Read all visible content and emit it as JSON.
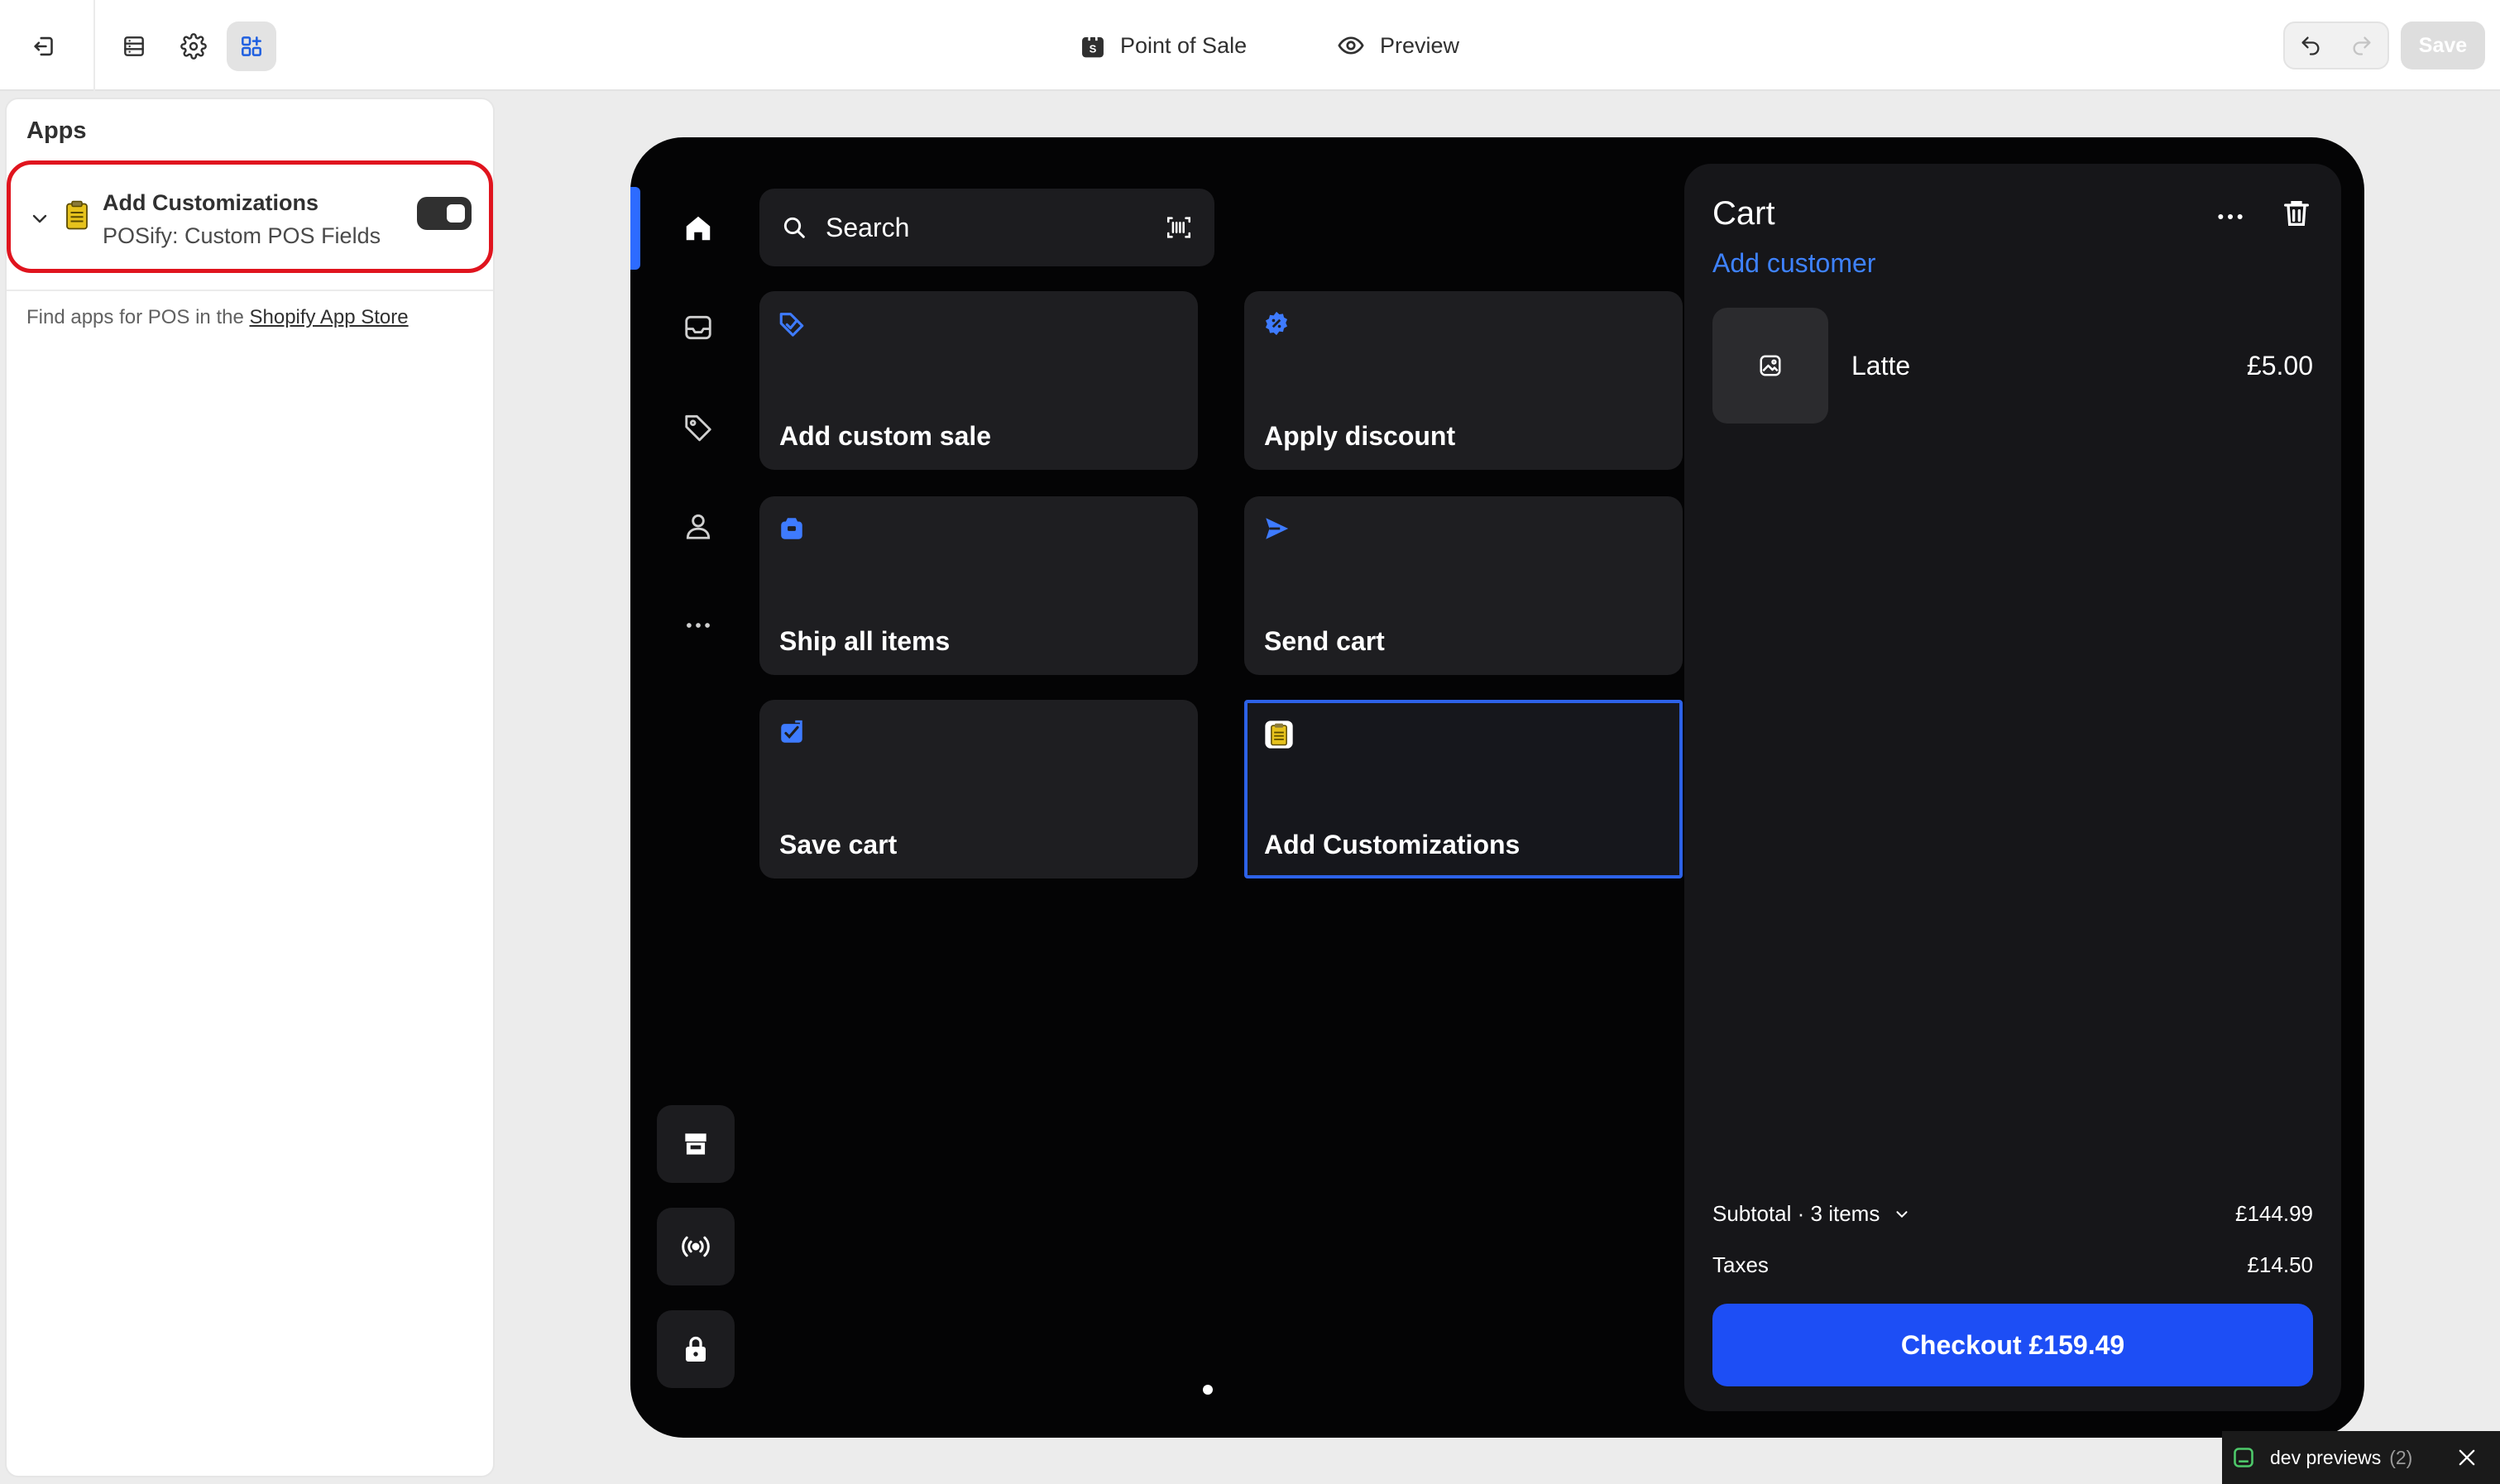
{
  "topbar": {
    "center_items": [
      {
        "label": "Point of Sale",
        "icon": "shopify-bag-icon"
      },
      {
        "label": "Preview",
        "icon": "eye-icon"
      }
    ],
    "save_label": "Save"
  },
  "panel": {
    "title": "Apps",
    "app": {
      "name": "Add Customizations",
      "subtitle": "POSify: Custom POS Fields",
      "enabled": true
    },
    "find_text": "Find apps for POS in the ",
    "find_link": "Shopify App Store"
  },
  "pos": {
    "search_placeholder": "Search",
    "tiles": [
      {
        "label": "Add custom sale",
        "icon": "custom-sale-icon"
      },
      {
        "label": "Apply discount",
        "icon": "discount-icon"
      },
      {
        "label": "Ship all items",
        "icon": "ship-icon"
      },
      {
        "label": "Send cart",
        "icon": "send-icon"
      },
      {
        "label": "Save cart",
        "icon": "save-cart-icon"
      },
      {
        "label": "Add Customizations",
        "icon": "clipboard-icon",
        "selected": true
      }
    ],
    "cart": {
      "title": "Cart",
      "add_customer": "Add customer",
      "line_items": [
        {
          "name": "Latte",
          "price": "£5.00"
        }
      ],
      "subtotal_label": "Subtotal · 3 items",
      "subtotal_value": "£144.99",
      "taxes_label": "Taxes",
      "taxes_value": "£14.50",
      "checkout_label": "Checkout £159.49"
    }
  },
  "dev_previews": {
    "label": "dev previews",
    "count": "(2)"
  },
  "colors": {
    "accent_blue": "#1d4ef5",
    "link_blue": "#3e82ff",
    "highlight_red": "#e0141e"
  }
}
